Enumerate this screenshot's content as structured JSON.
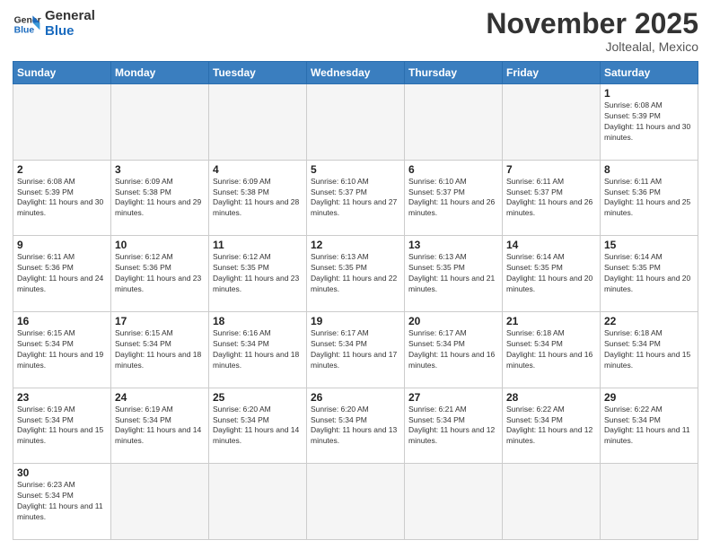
{
  "header": {
    "logo_general": "General",
    "logo_blue": "Blue",
    "month_title": "November 2025",
    "location": "Joltealal, Mexico"
  },
  "weekdays": [
    "Sunday",
    "Monday",
    "Tuesday",
    "Wednesday",
    "Thursday",
    "Friday",
    "Saturday"
  ],
  "days": [
    {
      "num": "",
      "empty": true
    },
    {
      "num": "",
      "empty": true
    },
    {
      "num": "",
      "empty": true
    },
    {
      "num": "",
      "empty": true
    },
    {
      "num": "",
      "empty": true
    },
    {
      "num": "",
      "empty": true
    },
    {
      "num": "1",
      "sunrise": "6:08 AM",
      "sunset": "5:39 PM",
      "daylight": "11 hours and 30 minutes."
    },
    {
      "num": "2",
      "sunrise": "6:08 AM",
      "sunset": "5:39 PM",
      "daylight": "11 hours and 30 minutes."
    },
    {
      "num": "3",
      "sunrise": "6:09 AM",
      "sunset": "5:38 PM",
      "daylight": "11 hours and 29 minutes."
    },
    {
      "num": "4",
      "sunrise": "6:09 AM",
      "sunset": "5:38 PM",
      "daylight": "11 hours and 28 minutes."
    },
    {
      "num": "5",
      "sunrise": "6:10 AM",
      "sunset": "5:37 PM",
      "daylight": "11 hours and 27 minutes."
    },
    {
      "num": "6",
      "sunrise": "6:10 AM",
      "sunset": "5:37 PM",
      "daylight": "11 hours and 26 minutes."
    },
    {
      "num": "7",
      "sunrise": "6:11 AM",
      "sunset": "5:37 PM",
      "daylight": "11 hours and 26 minutes."
    },
    {
      "num": "8",
      "sunrise": "6:11 AM",
      "sunset": "5:36 PM",
      "daylight": "11 hours and 25 minutes."
    },
    {
      "num": "9",
      "sunrise": "6:11 AM",
      "sunset": "5:36 PM",
      "daylight": "11 hours and 24 minutes."
    },
    {
      "num": "10",
      "sunrise": "6:12 AM",
      "sunset": "5:36 PM",
      "daylight": "11 hours and 23 minutes."
    },
    {
      "num": "11",
      "sunrise": "6:12 AM",
      "sunset": "5:35 PM",
      "daylight": "11 hours and 23 minutes."
    },
    {
      "num": "12",
      "sunrise": "6:13 AM",
      "sunset": "5:35 PM",
      "daylight": "11 hours and 22 minutes."
    },
    {
      "num": "13",
      "sunrise": "6:13 AM",
      "sunset": "5:35 PM",
      "daylight": "11 hours and 21 minutes."
    },
    {
      "num": "14",
      "sunrise": "6:14 AM",
      "sunset": "5:35 PM",
      "daylight": "11 hours and 20 minutes."
    },
    {
      "num": "15",
      "sunrise": "6:14 AM",
      "sunset": "5:35 PM",
      "daylight": "11 hours and 20 minutes."
    },
    {
      "num": "16",
      "sunrise": "6:15 AM",
      "sunset": "5:34 PM",
      "daylight": "11 hours and 19 minutes."
    },
    {
      "num": "17",
      "sunrise": "6:15 AM",
      "sunset": "5:34 PM",
      "daylight": "11 hours and 18 minutes."
    },
    {
      "num": "18",
      "sunrise": "6:16 AM",
      "sunset": "5:34 PM",
      "daylight": "11 hours and 18 minutes."
    },
    {
      "num": "19",
      "sunrise": "6:17 AM",
      "sunset": "5:34 PM",
      "daylight": "11 hours and 17 minutes."
    },
    {
      "num": "20",
      "sunrise": "6:17 AM",
      "sunset": "5:34 PM",
      "daylight": "11 hours and 16 minutes."
    },
    {
      "num": "21",
      "sunrise": "6:18 AM",
      "sunset": "5:34 PM",
      "daylight": "11 hours and 16 minutes."
    },
    {
      "num": "22",
      "sunrise": "6:18 AM",
      "sunset": "5:34 PM",
      "daylight": "11 hours and 15 minutes."
    },
    {
      "num": "23",
      "sunrise": "6:19 AM",
      "sunset": "5:34 PM",
      "daylight": "11 hours and 15 minutes."
    },
    {
      "num": "24",
      "sunrise": "6:19 AM",
      "sunset": "5:34 PM",
      "daylight": "11 hours and 14 minutes."
    },
    {
      "num": "25",
      "sunrise": "6:20 AM",
      "sunset": "5:34 PM",
      "daylight": "11 hours and 14 minutes."
    },
    {
      "num": "26",
      "sunrise": "6:20 AM",
      "sunset": "5:34 PM",
      "daylight": "11 hours and 13 minutes."
    },
    {
      "num": "27",
      "sunrise": "6:21 AM",
      "sunset": "5:34 PM",
      "daylight": "11 hours and 12 minutes."
    },
    {
      "num": "28",
      "sunrise": "6:22 AM",
      "sunset": "5:34 PM",
      "daylight": "11 hours and 12 minutes."
    },
    {
      "num": "29",
      "sunrise": "6:22 AM",
      "sunset": "5:34 PM",
      "daylight": "11 hours and 11 minutes."
    },
    {
      "num": "30",
      "sunrise": "6:23 AM",
      "sunset": "5:34 PM",
      "daylight": "11 hours and 11 minutes."
    },
    {
      "num": "",
      "empty": true
    },
    {
      "num": "",
      "empty": true
    },
    {
      "num": "",
      "empty": true
    },
    {
      "num": "",
      "empty": true
    },
    {
      "num": "",
      "empty": true
    },
    {
      "num": "",
      "empty": true
    }
  ]
}
